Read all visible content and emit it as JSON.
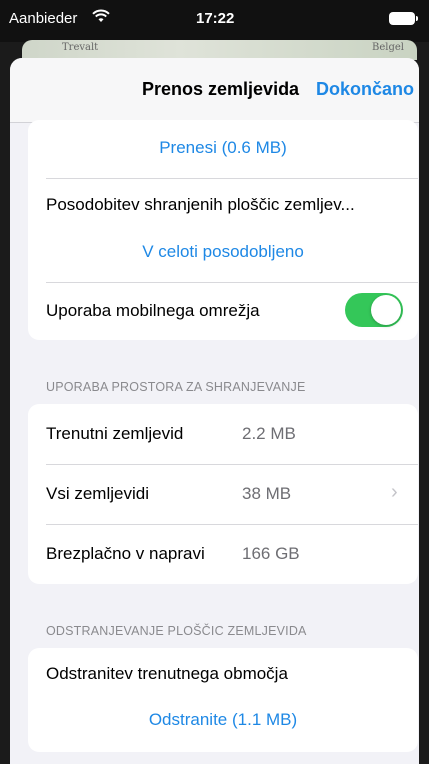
{
  "status_bar": {
    "carrier": "Aanbieder",
    "time": "17:22"
  },
  "map_peek": {
    "left_label": "Trevalt",
    "right_label": "Belgel"
  },
  "nav": {
    "title": "Prenos zemljevida",
    "done": "Dokončano"
  },
  "download_group": {
    "download_link": "Prenesi (0.6 MB)",
    "update_label": "Posodobitev shranjenih ploščic zemljev...",
    "update_status": "V celoti posodobljeno",
    "mobile_label": "Uporaba mobilnega omrežja",
    "mobile_enabled": true
  },
  "storage": {
    "header": "UPORABA PROSTORA ZA SHRANJEVANJE",
    "rows": [
      {
        "label": "Trenutni zemljevid",
        "value": "2.2 MB"
      },
      {
        "label": "Vsi zemljevidi",
        "value": "38 MB"
      },
      {
        "label": "Brezplačno v napravi",
        "value": "166 GB"
      }
    ]
  },
  "remove": {
    "header": "ODSTRANJEVANJE PLOŠČIC ZEMLJEVIDA",
    "area_label": "Odstranitev trenutnega območja",
    "remove_link": "Odstranite (1.1 MB)"
  },
  "colors": {
    "accent": "#1e88e5",
    "toggle_on": "#34c759",
    "background": "#f2f2f7"
  }
}
